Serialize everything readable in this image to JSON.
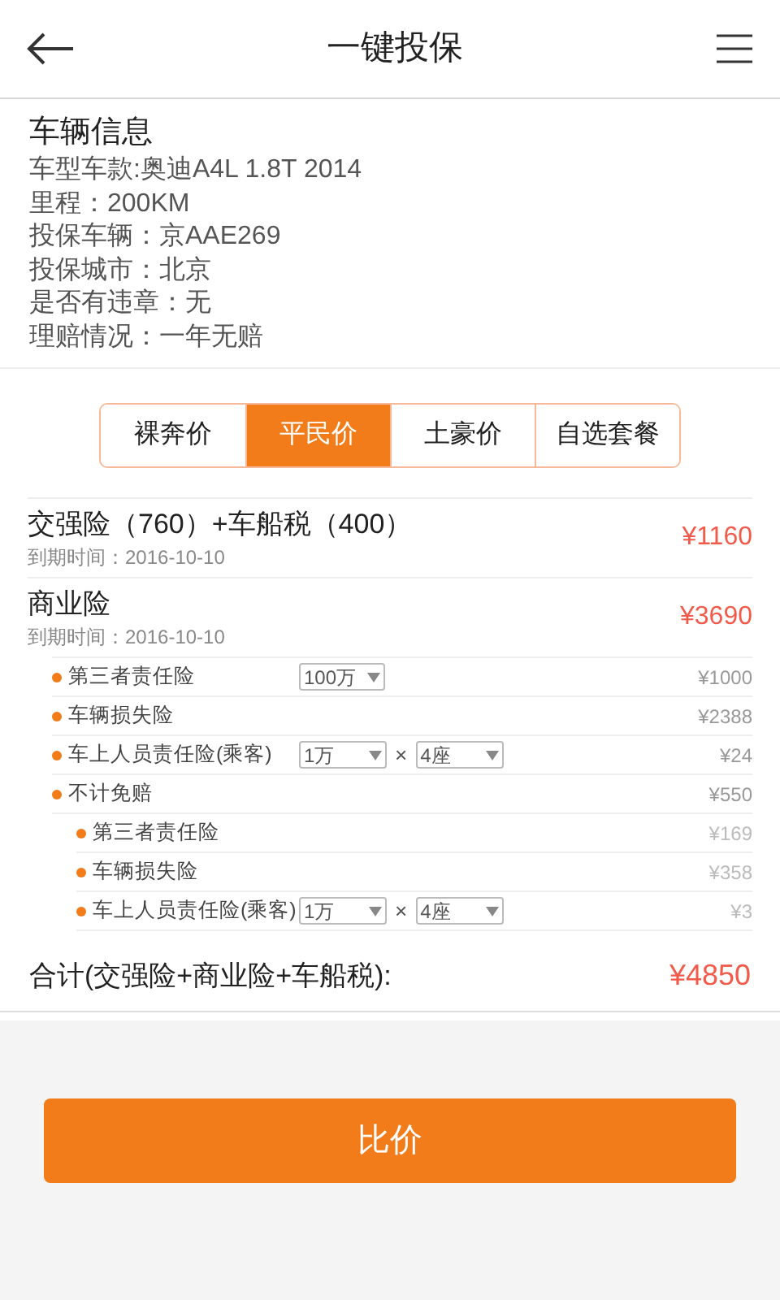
{
  "header": {
    "title": "一键投保"
  },
  "vehicle_info": {
    "title": "车辆信息",
    "lines": [
      "车型车款:奥迪A4L 1.8T 2014",
      "里程：200KM",
      "投保车辆：京AAE269",
      "投保城市：北京",
      "是否有违章：无",
      "理赔情况：一年无赔"
    ]
  },
  "plans": [
    {
      "label": "裸奔价",
      "selected": false
    },
    {
      "label": "平民价",
      "selected": true
    },
    {
      "label": "土豪价",
      "selected": false
    },
    {
      "label": "自选套餐",
      "selected": false
    }
  ],
  "policies": [
    {
      "name": "交强险（760）+车船税（400）",
      "expiry": "到期时间：2016-10-10",
      "price": "¥1160"
    },
    {
      "name": "商业险",
      "expiry": "到期时间：2016-10-10",
      "price": "¥3690"
    }
  ],
  "coverages": [
    {
      "name": "第三者责任险",
      "selects": [
        "100万"
      ],
      "price": "¥1000"
    },
    {
      "name": "车辆损失险",
      "price": "¥2388"
    },
    {
      "name": "车上人员责任险(乘客)",
      "selects": [
        "1万",
        "4座"
      ],
      "times": "×",
      "price": "¥24"
    },
    {
      "name": "不计免赔",
      "price": "¥550",
      "children": [
        {
          "name": "第三者责任险",
          "price": "¥169"
        },
        {
          "name": "车辆损失险",
          "price": "¥358"
        },
        {
          "name": "车上人员责任险(乘客)",
          "selects": [
            "1万",
            "4座"
          ],
          "times": "×",
          "price": "¥3"
        }
      ]
    }
  ],
  "total": {
    "label": "合计(交强险+商业险+车船税):",
    "amount": "¥4850"
  },
  "compare_button": "比价"
}
